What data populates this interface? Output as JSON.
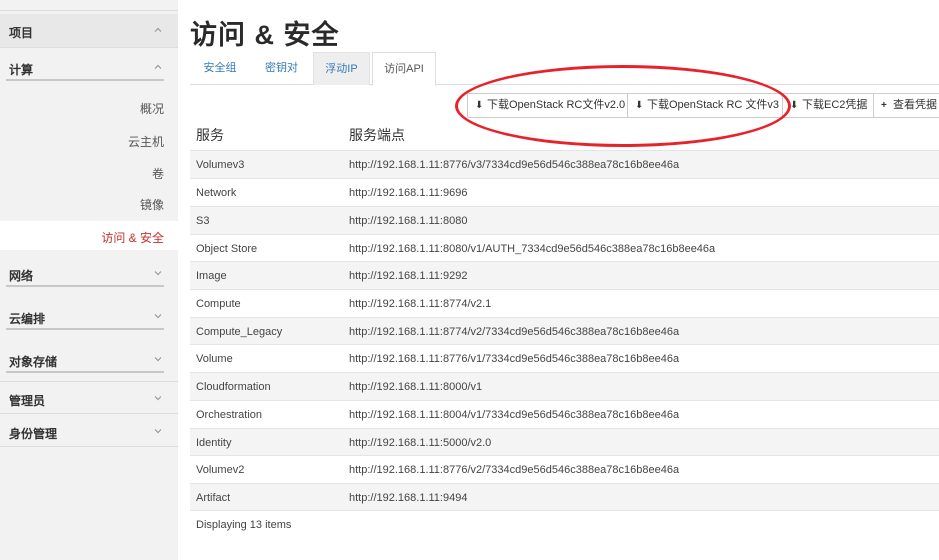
{
  "sidebar": {
    "project": "项目",
    "compute": "计算",
    "compute_items": [
      "概况",
      "云主机",
      "卷",
      "镜像"
    ],
    "active_item": "访问 & 安全",
    "network": "网络",
    "orchestration": "云编排",
    "object_storage": "对象存储",
    "admin": "管理员",
    "identity": "身份管理"
  },
  "page": {
    "title": "访问 & 安全"
  },
  "tabs": [
    {
      "label": "安全组"
    },
    {
      "label": "密钥对"
    },
    {
      "label": "浮动IP"
    },
    {
      "label": "访问API"
    }
  ],
  "buttons": {
    "download_rc_v2": "下载OpenStack RC文件v2.0",
    "download_rc_v3": "下载OpenStack RC 文件v3",
    "download_ec2": "下载EC2凭据",
    "view_credentials": "查看凭据"
  },
  "table": {
    "headers": [
      "服务",
      "服务端点"
    ],
    "rows": [
      [
        "Volumev3",
        "http://192.168.1.11:8776/v3/7334cd9e56d546c388ea78c16b8ee46a"
      ],
      [
        "Network",
        "http://192.168.1.11:9696"
      ],
      [
        "S3",
        "http://192.168.1.11:8080"
      ],
      [
        "Object Store",
        "http://192.168.1.11:8080/v1/AUTH_7334cd9e56d546c388ea78c16b8ee46a"
      ],
      [
        "Image",
        "http://192.168.1.11:9292"
      ],
      [
        "Compute",
        "http://192.168.1.11:8774/v2.1"
      ],
      [
        "Compute_Legacy",
        "http://192.168.1.11:8774/v2/7334cd9e56d546c388ea78c16b8ee46a"
      ],
      [
        "Volume",
        "http://192.168.1.11:8776/v1/7334cd9e56d546c388ea78c16b8ee46a"
      ],
      [
        "Cloudformation",
        "http://192.168.1.11:8000/v1"
      ],
      [
        "Orchestration",
        "http://192.168.1.11:8004/v1/7334cd9e56d546c388ea78c16b8ee46a"
      ],
      [
        "Identity",
        "http://192.168.1.11:5000/v2.0"
      ],
      [
        "Volumev2",
        "http://192.168.1.11:8776/v2/7334cd9e56d546c388ea78c16b8ee46a"
      ],
      [
        "Artifact",
        "http://192.168.1.11:9494"
      ]
    ],
    "footer": "Displaying 13 items"
  },
  "colors": {
    "annotation_circle": "#e8222a",
    "active_link": "#c9302c",
    "tab_link": "#337ab7"
  }
}
